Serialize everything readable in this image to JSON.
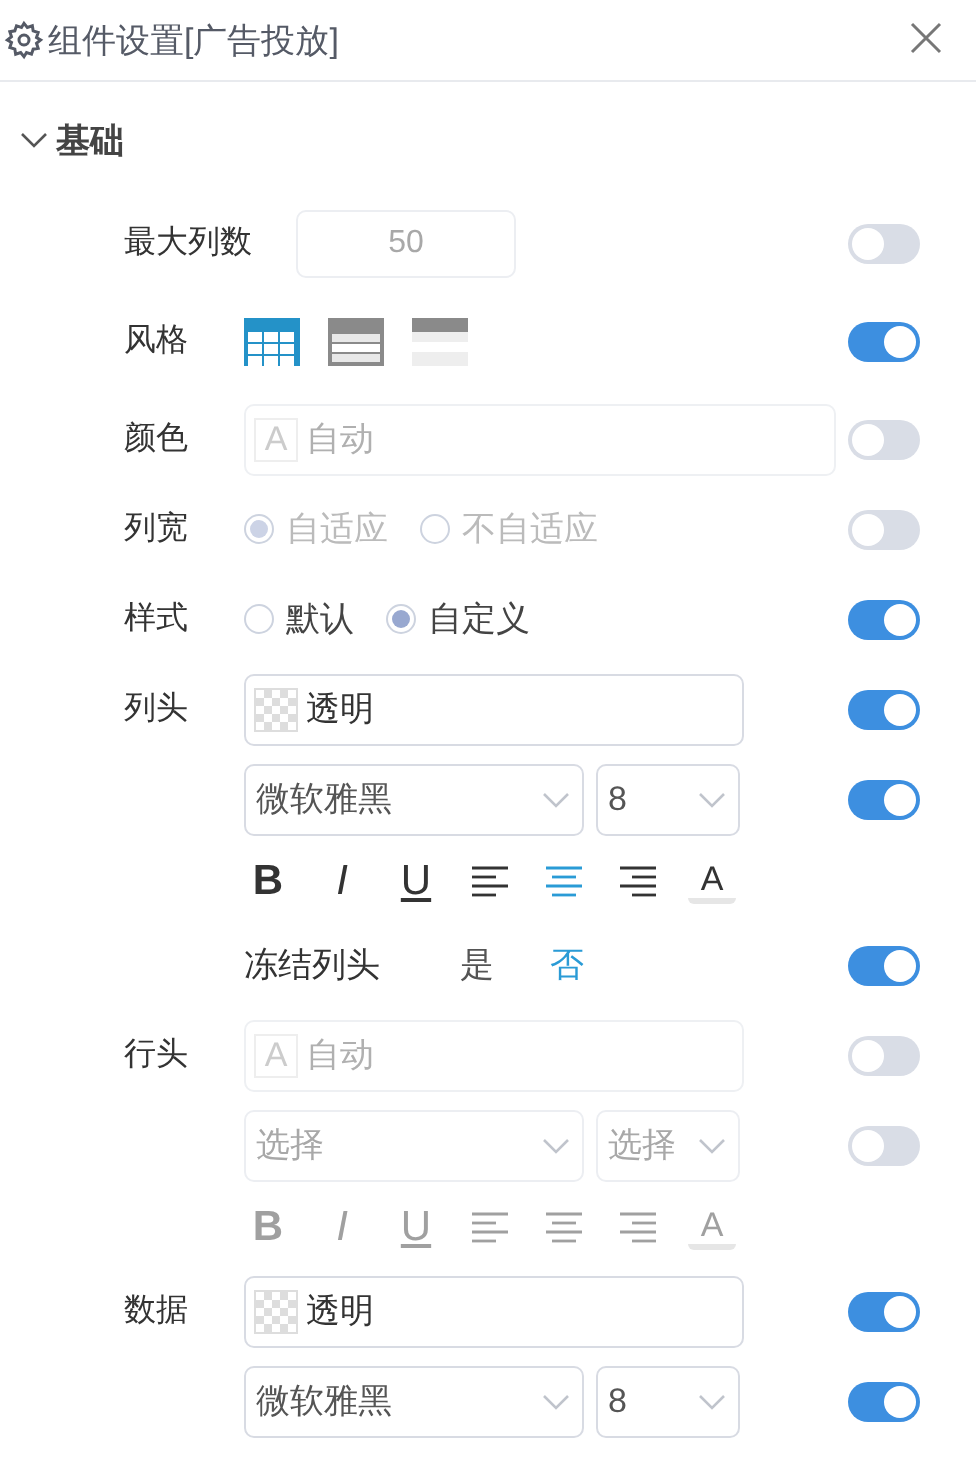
{
  "panel": {
    "title": "组件设置[广告投放]"
  },
  "section": {
    "title": "基础",
    "expanded": true
  },
  "rows": [
    {
      "kind": "number",
      "label": "最大列数",
      "value": "50",
      "disabled": true,
      "on": false
    },
    {
      "kind": "styles",
      "label": "风格",
      "options": [
        {
          "kind": "grid",
          "selected": true
        },
        {
          "kind": "banded",
          "selected": false
        },
        {
          "kind": "header",
          "selected": false
        }
      ],
      "on": true
    },
    {
      "kind": "color",
      "label": "颜色",
      "wide": true,
      "swatch": {
        "kind": "glyph",
        "text": "A"
      },
      "value": "自动",
      "disabled": true,
      "on": false
    },
    {
      "kind": "radio",
      "label": "列宽",
      "options": [
        {
          "label": "自适应",
          "selected": true
        },
        {
          "label": "不自适应",
          "selected": false
        }
      ],
      "disabled": true,
      "on": false
    },
    {
      "kind": "radio",
      "label": "样式",
      "options": [
        {
          "label": "默认",
          "selected": false
        },
        {
          "label": "自定义",
          "selected": true
        }
      ],
      "disabled": false,
      "on": true
    },
    {
      "kind": "color",
      "label": "列头",
      "wide": false,
      "swatch": {
        "kind": "checker"
      },
      "value": "透明",
      "disabled": false,
      "on": true
    },
    {
      "kind": "font",
      "font": {
        "value": "微软雅黑"
      },
      "size": {
        "value": "8"
      },
      "disabled": false,
      "on": true,
      "toolbar": [
        {
          "kind": "bold",
          "text": "B",
          "selected": false
        },
        {
          "kind": "italic",
          "text": "I",
          "selected": false
        },
        {
          "kind": "underline",
          "text": "U",
          "selected": false
        },
        {
          "kind": "align-left",
          "selected": false
        },
        {
          "kind": "align-center",
          "selected": true
        },
        {
          "kind": "align-right",
          "selected": false
        },
        {
          "kind": "color",
          "text": "A",
          "selected": false
        }
      ]
    },
    {
      "kind": "choice",
      "text": "冻结列头",
      "options": [
        {
          "label": "是",
          "selected": false
        },
        {
          "label": "否",
          "selected": true
        }
      ],
      "on": true
    },
    {
      "kind": "color",
      "label": "行头",
      "wide": false,
      "swatch": {
        "kind": "glyph",
        "text": "A"
      },
      "value": "自动",
      "disabled": true,
      "on": false
    },
    {
      "kind": "font",
      "font": {
        "placeholder": "选择"
      },
      "size": {
        "placeholder": "选择"
      },
      "disabled": true,
      "on": false,
      "toolbar": [
        {
          "kind": "bold",
          "text": "B",
          "selected": false
        },
        {
          "kind": "italic",
          "text": "I",
          "selected": false
        },
        {
          "kind": "underline",
          "text": "U",
          "selected": false
        },
        {
          "kind": "align-left",
          "selected": false
        },
        {
          "kind": "align-center",
          "selected": false
        },
        {
          "kind": "align-right",
          "selected": false
        },
        {
          "kind": "color",
          "text": "A",
          "selected": false
        }
      ]
    },
    {
      "kind": "color",
      "label": "数据",
      "wide": false,
      "swatch": {
        "kind": "checker"
      },
      "value": "透明",
      "disabled": false,
      "on": true
    },
    {
      "kind": "font",
      "font": {
        "value": "微软雅黑"
      },
      "size": {
        "value": "8"
      },
      "disabled": false,
      "on": true
    }
  ]
}
